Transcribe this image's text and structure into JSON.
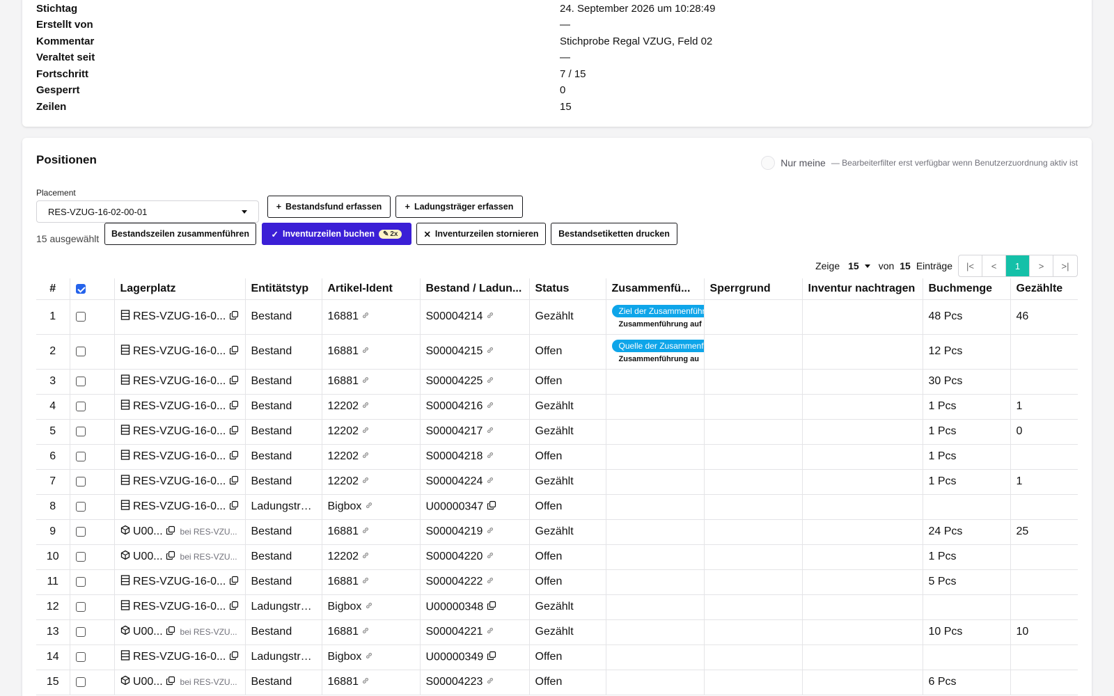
{
  "details": [
    {
      "label": "Stichtag",
      "value": "24. September 2026 um 10:28:49"
    },
    {
      "label": "Erstellt von",
      "value": "—"
    },
    {
      "label": "Kommentar",
      "value": "Stichprobe Regal VZUG, Feld 02"
    },
    {
      "label": "Veraltet seit",
      "value": "—"
    },
    {
      "label": "Fortschritt",
      "value": "7 / 15"
    },
    {
      "label": "Gesperrt",
      "value": "0"
    },
    {
      "label": "Zeilen",
      "value": "15"
    }
  ],
  "positions": {
    "title": "Positionen",
    "filter_label": "Nur meine",
    "filter_hint": "— Bearbeiterfilter erst verfügbar wenn Benutzerzuordnung aktiv ist",
    "placement_label": "Placement",
    "placement_value": "RES-VZUG-16-02-00-01",
    "btn_bestandsfund": "Bestandsfund erfassen",
    "btn_ladungstraeger": "Ladungsträger erfassen",
    "selected_count": "15 ausgewählt",
    "btn_merge": "Bestandszeilen zusammenführen",
    "btn_book": "Inventurzeilen buchen",
    "btn_book_badge": "2x",
    "btn_cancel": "Inventurzeilen stornieren",
    "btn_print": "Bestandsetiketten drucken"
  },
  "pager": {
    "show_label": "Zeige",
    "page_size": "15",
    "of_label": "von",
    "total": "15",
    "entries_label": "Einträge",
    "first": "|<",
    "prev": "<",
    "current": "1",
    "next": ">",
    "last": ">|"
  },
  "table": {
    "headers": [
      "#",
      "",
      "Lagerplatz",
      "Entitätstyp",
      "Artikel-Ident",
      "Bestand / Ladun...",
      "Status",
      "Zusammenfü...",
      "Sperrgrund",
      "Inventur nachtragen",
      "Buchmenge",
      "Gezählte"
    ],
    "rows": [
      {
        "num": "1",
        "icon": "shelf",
        "lager": "RES-VZUG-16-0...",
        "lager_hint": "",
        "typ": "Bestand",
        "artikel": "16881",
        "artikel_icon": "link",
        "bestand": "S00004214",
        "bestand_icon": "link",
        "status": "Gezählt",
        "zusammen_tag": "Ziel der Zusammenführung",
        "zusammen_sub": "Zusammenführung auf",
        "buchmenge": "48 Pcs",
        "gezaehlt": "46"
      },
      {
        "num": "2",
        "icon": "shelf",
        "lager": "RES-VZUG-16-0...",
        "lager_hint": "",
        "typ": "Bestand",
        "artikel": "16881",
        "artikel_icon": "link",
        "bestand": "S00004215",
        "bestand_icon": "link",
        "status": "Offen",
        "zusammen_tag": "Quelle der Zusammenführung",
        "zusammen_sub": "Zusammenführung au",
        "buchmenge": "12 Pcs",
        "gezaehlt": ""
      },
      {
        "num": "3",
        "icon": "shelf",
        "lager": "RES-VZUG-16-0...",
        "lager_hint": "",
        "typ": "Bestand",
        "artikel": "16881",
        "artikel_icon": "link",
        "bestand": "S00004225",
        "bestand_icon": "link",
        "status": "Offen",
        "zusammen_tag": "",
        "zusammen_sub": "",
        "buchmenge": "30 Pcs",
        "gezaehlt": ""
      },
      {
        "num": "4",
        "icon": "shelf",
        "lager": "RES-VZUG-16-0...",
        "lager_hint": "",
        "typ": "Bestand",
        "artikel": "12202",
        "artikel_icon": "link",
        "bestand": "S00004216",
        "bestand_icon": "link",
        "status": "Gezählt",
        "zusammen_tag": "",
        "zusammen_sub": "",
        "buchmenge": "1 Pcs",
        "gezaehlt": "1"
      },
      {
        "num": "5",
        "icon": "shelf",
        "lager": "RES-VZUG-16-0...",
        "lager_hint": "",
        "typ": "Bestand",
        "artikel": "12202",
        "artikel_icon": "link",
        "bestand": "S00004217",
        "bestand_icon": "link",
        "status": "Gezählt",
        "zusammen_tag": "",
        "zusammen_sub": "",
        "buchmenge": "1 Pcs",
        "gezaehlt": "0"
      },
      {
        "num": "6",
        "icon": "shelf",
        "lager": "RES-VZUG-16-0...",
        "lager_hint": "",
        "typ": "Bestand",
        "artikel": "12202",
        "artikel_icon": "link",
        "bestand": "S00004218",
        "bestand_icon": "link",
        "status": "Offen",
        "zusammen_tag": "",
        "zusammen_sub": "",
        "buchmenge": "1 Pcs",
        "gezaehlt": ""
      },
      {
        "num": "7",
        "icon": "shelf",
        "lager": "RES-VZUG-16-0...",
        "lager_hint": "",
        "typ": "Bestand",
        "artikel": "12202",
        "artikel_icon": "link",
        "bestand": "S00004224",
        "bestand_icon": "link",
        "status": "Gezählt",
        "zusammen_tag": "",
        "zusammen_sub": "",
        "buchmenge": "1 Pcs",
        "gezaehlt": "1"
      },
      {
        "num": "8",
        "icon": "shelf",
        "lager": "RES-VZUG-16-0...",
        "lager_hint": "",
        "typ": "Ladungsträ...",
        "artikel": "Bigbox",
        "artikel_icon": "link",
        "bestand": "U00000347",
        "bestand_icon": "copy",
        "status": "Offen",
        "zusammen_tag": "",
        "zusammen_sub": "",
        "buchmenge": "",
        "gezaehlt": ""
      },
      {
        "num": "9",
        "icon": "box",
        "lager": "U00...",
        "lager_hint": "bei RES-VZU...",
        "typ": "Bestand",
        "artikel": "16881",
        "artikel_icon": "link",
        "bestand": "S00004219",
        "bestand_icon": "link",
        "status": "Gezählt",
        "zusammen_tag": "",
        "zusammen_sub": "",
        "buchmenge": "24 Pcs",
        "gezaehlt": "25"
      },
      {
        "num": "10",
        "icon": "box",
        "lager": "U00...",
        "lager_hint": "bei RES-VZU...",
        "typ": "Bestand",
        "artikel": "12202",
        "artikel_icon": "link",
        "bestand": "S00004220",
        "bestand_icon": "link",
        "status": "Offen",
        "zusammen_tag": "",
        "zusammen_sub": "",
        "buchmenge": "1 Pcs",
        "gezaehlt": ""
      },
      {
        "num": "11",
        "icon": "shelf",
        "lager": "RES-VZUG-16-0...",
        "lager_hint": "",
        "typ": "Bestand",
        "artikel": "16881",
        "artikel_icon": "link",
        "bestand": "S00004222",
        "bestand_icon": "link",
        "status": "Offen",
        "zusammen_tag": "",
        "zusammen_sub": "",
        "buchmenge": "5 Pcs",
        "gezaehlt": ""
      },
      {
        "num": "12",
        "icon": "shelf",
        "lager": "RES-VZUG-16-0...",
        "lager_hint": "",
        "typ": "Ladungsträ...",
        "artikel": "Bigbox",
        "artikel_icon": "link",
        "bestand": "U00000348",
        "bestand_icon": "copy",
        "status": "Gezählt",
        "zusammen_tag": "",
        "zusammen_sub": "",
        "buchmenge": "",
        "gezaehlt": ""
      },
      {
        "num": "13",
        "icon": "box",
        "lager": "U00...",
        "lager_hint": "bei RES-VZU...",
        "typ": "Bestand",
        "artikel": "16881",
        "artikel_icon": "link",
        "bestand": "S00004221",
        "bestand_icon": "link",
        "status": "Gezählt",
        "zusammen_tag": "",
        "zusammen_sub": "",
        "buchmenge": "10 Pcs",
        "gezaehlt": "10"
      },
      {
        "num": "14",
        "icon": "shelf",
        "lager": "RES-VZUG-16-0...",
        "lager_hint": "",
        "typ": "Ladungsträ...",
        "artikel": "Bigbox",
        "artikel_icon": "link",
        "bestand": "U00000349",
        "bestand_icon": "copy",
        "status": "Offen",
        "zusammen_tag": "",
        "zusammen_sub": "",
        "buchmenge": "",
        "gezaehlt": ""
      },
      {
        "num": "15",
        "icon": "box",
        "lager": "U00...",
        "lager_hint": "bei RES-VZU...",
        "typ": "Bestand",
        "artikel": "16881",
        "artikel_icon": "link",
        "bestand": "S00004223",
        "bestand_icon": "link",
        "status": "Offen",
        "zusammen_tag": "",
        "zusammen_sub": "",
        "buchmenge": "6 Pcs",
        "gezaehlt": ""
      }
    ]
  },
  "colors": {
    "primary": "#3b1fd6",
    "accent": "#14c0a8",
    "tag": "#0ea5e9",
    "checkbox": "#2563eb"
  }
}
